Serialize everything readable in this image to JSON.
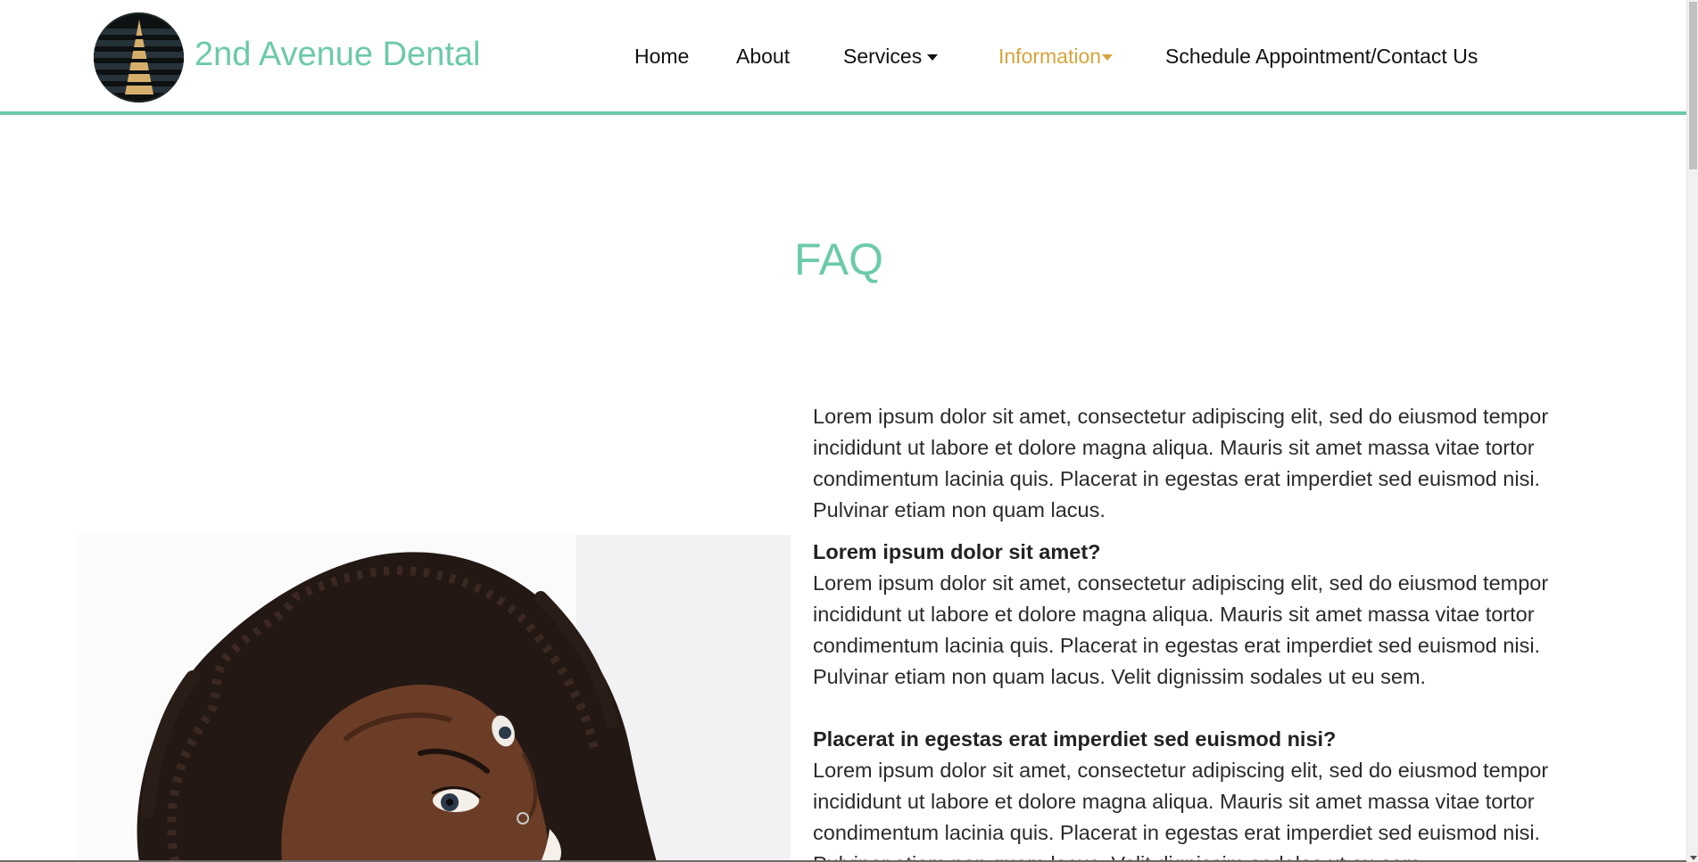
{
  "header": {
    "brand": "2nd Avenue Dental",
    "nav": {
      "home": "Home",
      "about": "About",
      "services": "Services",
      "information": "Information",
      "contact": "Schedule Appointment/Contact Us"
    },
    "active_color": "#d6a43c",
    "accent_color": "#6ccaa9"
  },
  "main": {
    "title": "FAQ",
    "intro": "Lorem ipsum dolor sit amet, consectetur adipiscing elit, sed do eiusmod tempor incididunt ut labore et dolore magna aliqua. Mauris sit amet massa vitae tortor condimentum lacinia quis. Placerat in egestas erat imperdiet sed euismod nisi. Pulvinar etiam non quam lacus.",
    "faqs": [
      {
        "question": "Lorem ipsum dolor sit amet?",
        "answer": "Lorem ipsum dolor sit amet, consectetur adipiscing elit, sed do eiusmod tempor incididunt ut labore et dolore magna aliqua. Mauris sit amet massa vitae tortor condimentum lacinia quis. Placerat in egestas erat imperdiet sed euismod nisi. Pulvinar etiam non quam lacus. Velit dignissim sodales ut eu sem."
      },
      {
        "question": "Placerat in egestas erat imperdiet sed euismod nisi?",
        "answer": "Lorem ipsum dolor sit amet, consectetur adipiscing elit, sed do eiusmod tempor incididunt ut labore et dolore magna aliqua. Mauris sit amet massa vitae tortor condimentum lacinia quis. Placerat in egestas erat imperdiet sed euismod nisi. Pulvinar etiam non quam lacus. Velit dignissim sodales ut eu sem."
      }
    ]
  },
  "icons": {
    "logo": "road-logo-icon",
    "dropdown": "caret-down-icon"
  }
}
